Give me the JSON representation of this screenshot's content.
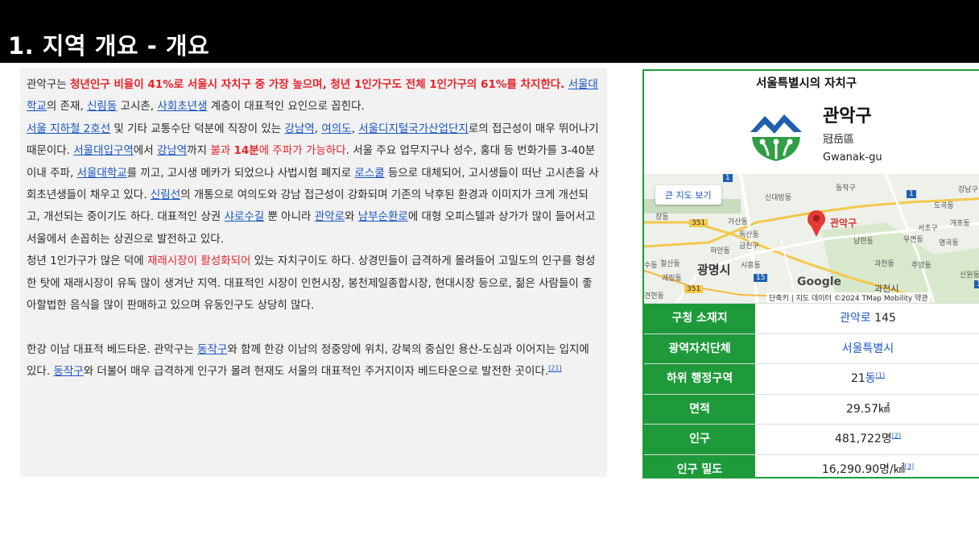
{
  "slide": {
    "title": "1. 지역 개요 - 개요"
  },
  "article": {
    "p1": {
      "a": "관악구는 ",
      "b": "청년인구 비율이 41%로 서울시 자치구 중 가장 높으며, 청년 1인가구도 전체 1인가구의 61%를 차지한다.",
      "c": " ",
      "l1": "서울대학교",
      "d": "의 존재, ",
      "l2": "신림동",
      "e": " 고시촌, ",
      "l3": "사회초년생",
      "f": " 계층이 대표적인 요인으로 꼽힌다."
    },
    "p2": {
      "a": " ",
      "l1": "서울 지하철 2호선",
      "b": " 및 기타 교통수단 덕분에 직장이 있는 ",
      "l2": "강남역",
      "c": ", ",
      "l3": "여의도",
      "d": ", ",
      "l4": "서울디지털국가산업단지",
      "e": "로의 접근성이 매우 뛰어나기 때문이다. ",
      "l5": "서울대입구역",
      "f": "에서 ",
      "l6": "강남역",
      "g": "까지 ",
      "r1": "불과 ",
      "rb": "14분",
      "r2": "에 주파가 가능하다",
      "h": ".  서울 주요 업무지구나 성수, 홍대 등 번화가를 3-40분 이내 주파,  ",
      "l7": "서울대학교",
      "i": "를 끼고, 고시생 메카가 되었으나 사법시험 폐지로 ",
      "l8": "로스쿨",
      "j": " 등으로 대체되어, 고시생들이 떠난 고시촌을 사회초년생들이 채우고 있다. ",
      "l9": "신림선",
      "k": "의 개통으로 여의도와 강남 접근성이 강화되며  기존의 낙후된 환경과 이미지가 크게 개선되고, 개선되는 중이기도 하다.  대표적인 상권 ",
      "l10": "샤로수길",
      "l": " 뿐 아니라 ",
      "l11": "관악로",
      "m": "와 ",
      "l12": "남부순환로",
      "n": "에 대형 오피스텔과 상가가 많이 들어서고 서울에서 손꼽히는 상권으로 발전하고 있다."
    },
    "p3": {
      "a": "청년 1인가구가 많은 덕에 ",
      "r": "재래시장이 활성화되어",
      "b": " 있는 자치구이도 하다.  상경민들이 급격하게 몰려들어 고밀도의 인구를 형성한 탓에 재래시장이 유독 많이 생겨난 지역. 대표적인 시장이 인헌시장, 봉천제일종합시장, 현대시장 등으로, 젊은 사람들이 좋아할법한 음식을 많이 판매하고 있으며 유동인구도 상당히 많다."
    },
    "p4": {
      "a": "한강 이남 대표적 베드타운.  관악구는 ",
      "l1": "동작구",
      "b": "와 함께 한강 이남의 정중앙에 위치, 강북의 중심인 용산-도심과 이어지는 입지에 있다.  ",
      "l2": "동작구",
      "c": "와 더불어 매우 급격하게 인구가 몰려 현재도 서울의 대표적인 주거지이자 베드타운으로 발전한 곳이다.",
      "ref": "[21]"
    }
  },
  "infobox": {
    "header": "서울특별시의 자치구",
    "name": "관악구",
    "hanja": "冠岳區",
    "roman": "Gwanak-gu",
    "emblem_colors": {
      "blue": "#1f5fae",
      "green": "#2f9e44"
    },
    "map": {
      "button": "큰 지도 보기",
      "pin_label": "관악구",
      "google": "Google",
      "attribution": "단축키 | 지도 데이터 ©2024 TMap Mobility   약관",
      "places": {
        "sindaebang": "신대방동",
        "dongjak": "동작구",
        "gangnam": "강남구",
        "dogok": "도곡동",
        "gaepo": "개포동",
        "seocho": "서초구",
        "umyeon": "우면동",
        "yeomgok": "염곡동",
        "gasan": "가산동",
        "doksan": "독산동",
        "geumcheon": "금천구",
        "hain": "하안동",
        "siheung": "시흥동",
        "namhyeon": "남현동",
        "gwacheon": "과천동",
        "jungang": "주앙동",
        "sinwon": "신원동",
        "gwacheon_si": "과천시",
        "gwangmyeong": "광명시",
        "cheolsan": "철산동",
        "gwaerim": "괘림동",
        "gyeonghyeon": "견현동",
        "sudong": "수동",
        "changdong": "창동"
      },
      "shields": {
        "r351a": "351",
        "r351b": "351",
        "r15": "15",
        "r1a": "1",
        "r1b": "1",
        "r1c": "1"
      }
    },
    "rows": [
      {
        "key": "구청 소재지",
        "link": "관악로",
        "text": " 145",
        "ref": ""
      },
      {
        "key": "광역자치단체",
        "link": "서울특별시",
        "text": "",
        "ref": ""
      },
      {
        "key": "하위 행정구역",
        "text": "21",
        "link": "동",
        "ref": "[1]"
      },
      {
        "key": "면적",
        "text": "29.57㎢",
        "link": "",
        "ref": ""
      },
      {
        "key": "인구",
        "text": "481,722명",
        "link": "",
        "ref": "[2]"
      },
      {
        "key": "인구 밀도",
        "text": "16,290.90명/㎢",
        "link": "",
        "ref": "[3]"
      }
    ]
  }
}
